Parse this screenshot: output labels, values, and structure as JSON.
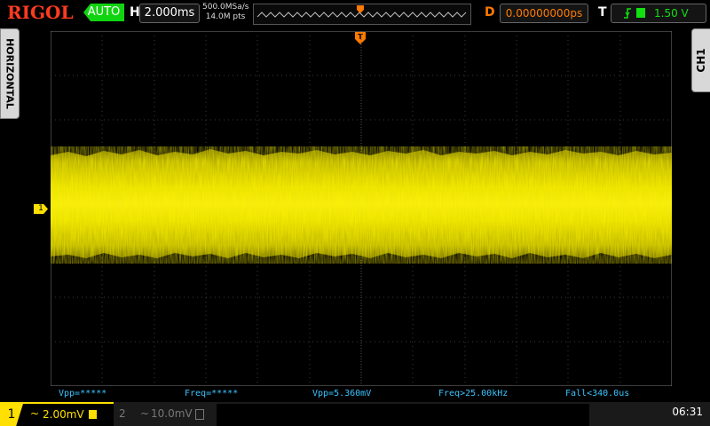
{
  "topbar": {
    "brand": "RIGOL",
    "run_state": "AUTO",
    "horizontal_letter": "H",
    "timebase": "2.000ms",
    "sample_rate": "500.0MSa/s",
    "memory_depth": "14.0M pts",
    "delay_letter": "D",
    "delay_value": "0.00000000ps",
    "trigger_letter": "T",
    "trigger_level": "1.50 V"
  },
  "side": {
    "left_label": "HORIZONTAL",
    "right_label": "CH1"
  },
  "channel_marker": "1",
  "measurements": {
    "vpp_1": "Vpp=*****",
    "freq_1": "Freq=*****",
    "vpp_2": "Vpp=5.360mV",
    "freq_2": "Freq>25.00kHz",
    "fall": "Fall<340.0us"
  },
  "bottom": {
    "ch1_number": "1",
    "ch1_scale": "2.00mV",
    "ch2_number": "2",
    "ch2_scale": "10.0mV",
    "time": "06:31"
  },
  "colors": {
    "brand": "#ff3b1f",
    "ch1": "#ffe000",
    "trigger": "#ff7a00",
    "measurement": "#3cc3ff",
    "run": "#11d411"
  }
}
